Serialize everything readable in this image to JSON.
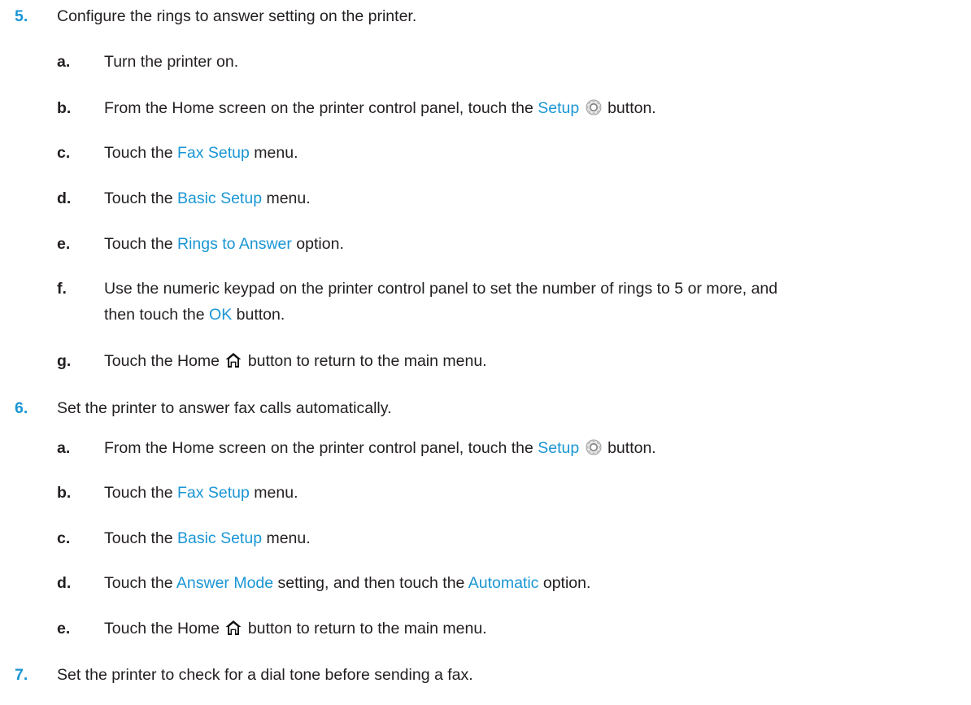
{
  "steps": [
    {
      "number": "5.",
      "text": "Configure the rings to answer setting on the printer.",
      "substeps": [
        {
          "letter": "a.",
          "parts": [
            "Turn the printer on."
          ]
        },
        {
          "letter": "b.",
          "pre": "From the Home screen on the printer control panel, touch the ",
          "ui": "Setup",
          "post": " button."
        },
        {
          "letter": "c.",
          "pre": "Touch the ",
          "ui": "Fax Setup",
          "post": " menu."
        },
        {
          "letter": "d.",
          "pre": "Touch the ",
          "ui": "Basic Setup",
          "post": " menu."
        },
        {
          "letter": "e.",
          "pre": "Touch the ",
          "ui": "Rings to Answer",
          "post": " option."
        },
        {
          "letter": "f.",
          "line1": "Use the numeric keypad on the printer control panel to set the number of rings to 5 or more, and",
          "pre2": "then touch the ",
          "ui": "OK",
          "post": " button."
        },
        {
          "letter": "g.",
          "pre": "Touch the Home ",
          "post": " button to return to the main menu."
        }
      ]
    },
    {
      "number": "6.",
      "text": "Set the printer to answer fax calls automatically.",
      "substeps": [
        {
          "letter": "a.",
          "pre": "From the Home screen on the printer control panel, touch the ",
          "ui": "Setup",
          "post": " button."
        },
        {
          "letter": "b.",
          "pre": "Touch the ",
          "ui": "Fax Setup",
          "post": " menu."
        },
        {
          "letter": "c.",
          "pre": "Touch the ",
          "ui": "Basic Setup",
          "post": " menu."
        },
        {
          "letter": "d.",
          "pre": "Touch the ",
          "ui": "Answer Mode",
          "mid": " setting, and then touch the ",
          "ui2": "Automatic",
          "post": " option."
        },
        {
          "letter": "e.",
          "pre": "Touch the Home ",
          "post": " button to return to the main menu."
        }
      ]
    },
    {
      "number": "7.",
      "text": "Set the printer to check for a dial tone before sending a fax."
    }
  ],
  "icons": {
    "setup": "gear-icon",
    "home": "home-icon"
  },
  "colors": {
    "accent": "#1a96d4",
    "text": "#231f20"
  }
}
